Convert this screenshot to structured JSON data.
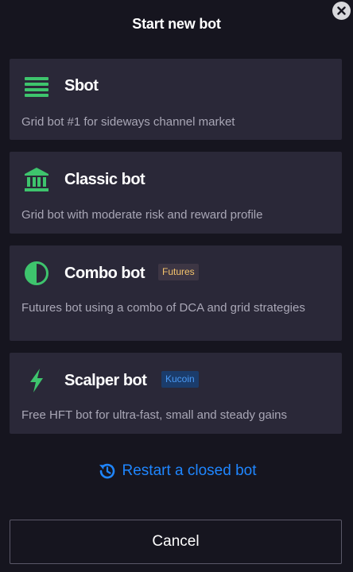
{
  "dialog": {
    "title": "Start new bot",
    "close_icon": "close-icon"
  },
  "bots": [
    {
      "name": "Sbot",
      "description": "Grid bot #1 for sideways channel market",
      "icon": "grid-lines-icon",
      "icon_color": "#3ec46d"
    },
    {
      "name": "Classic bot",
      "description": "Grid bot with moderate risk and reward profile",
      "icon": "bank-building-icon",
      "icon_color": "#3ec46d"
    },
    {
      "name": "Combo bot",
      "description": "Futures bot using a combo of DCA and grid strategies",
      "badge": "Futures",
      "icon": "half-circle-icon",
      "icon_color": "#3ec46d"
    },
    {
      "name": "Scalper bot",
      "description": "Free HFT bot for ultra-fast, small and steady gains",
      "badge": "Kucoin",
      "icon": "lightning-icon",
      "icon_color": "#3ec46d"
    }
  ],
  "restart": {
    "label": "Restart a closed bot",
    "icon": "restart-icon"
  },
  "cancel": {
    "label": "Cancel"
  },
  "colors": {
    "background": "#16151f",
    "card": "#2a2838",
    "accent_green": "#3ec46d",
    "link_blue": "#1f86ff",
    "futures_badge_text": "#f4c36c",
    "kucoin_badge_text": "#4a9af5"
  }
}
